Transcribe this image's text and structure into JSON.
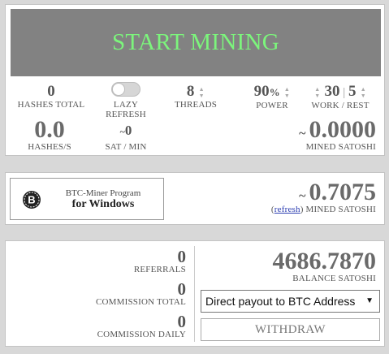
{
  "mining": {
    "start_label": "START MINING",
    "hashes_total_value": "0",
    "hashes_total_label": "HASHES TOTAL",
    "lazy_refresh_label": "LAZY REFRESH",
    "lazy_refresh_on": false,
    "threads_value": "8",
    "threads_label": "THREADS",
    "power_value": "90",
    "power_unit": "%",
    "power_label": "POWER",
    "work_value": "30",
    "rest_value": "5",
    "work_rest_label": "WORK / REST",
    "hashes_per_s_value": "0.0",
    "hashes_per_s_label": "HASHES/S",
    "sat_min_prefix": "~",
    "sat_min_value": "0",
    "sat_min_label": "SAT / MIN",
    "mined_prefix": "~",
    "mined_value": "0.0000",
    "mined_label": "MINED SATOSHI"
  },
  "program": {
    "line1": "BTC-Miner Program",
    "line2": "for Windows",
    "mined_prefix": "~",
    "mined_value": "0.7075",
    "refresh_open": "(",
    "refresh_label": "refresh",
    "refresh_close": ")",
    "mined_label": " MINED SATOSHI"
  },
  "account": {
    "referrals_value": "0",
    "referrals_label": "REFERRALS",
    "commission_total_value": "0",
    "commission_total_label": "COMMISSION TOTAL",
    "commission_daily_value": "0",
    "commission_daily_label": "COMMISSION DAILY",
    "balance_value": "4686.7870",
    "balance_label": "BALANCE SATOSHI",
    "payout_selected": "Direct payout to BTC Address",
    "withdraw_label": "WITHDRAW"
  },
  "colors": {
    "start_bg": "#828282",
    "start_text": "#7cf57c",
    "link": "#2a3cb0"
  }
}
